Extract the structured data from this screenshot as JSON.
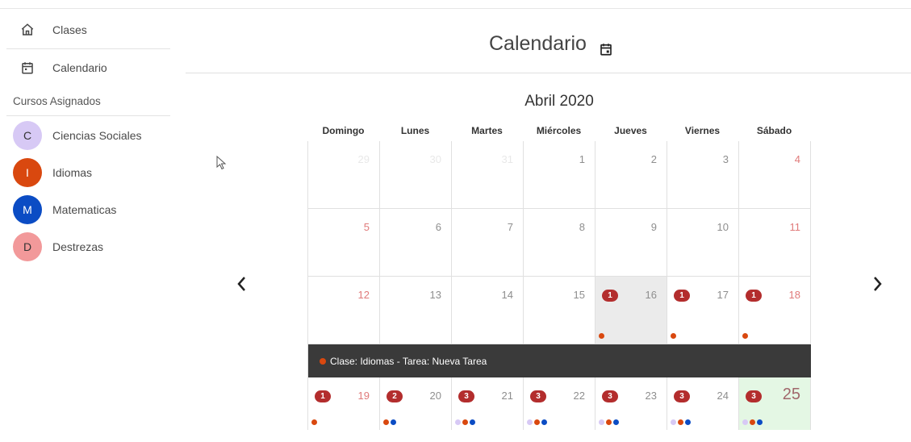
{
  "sidebar": {
    "nav": [
      {
        "label": "Clases",
        "icon": "home-icon"
      },
      {
        "label": "Calendario",
        "icon": "calendar-icon"
      }
    ],
    "section_label": "Cursos Asignados",
    "courses": [
      {
        "initial": "C",
        "name": "Ciencias Sociales",
        "color": "#d7c9f5",
        "text_color": "#333333"
      },
      {
        "initial": "I",
        "name": "Idiomas",
        "color": "#d9480f",
        "text_color": "#ffffff"
      },
      {
        "initial": "M",
        "name": "Matematicas",
        "color": "#0b4cc4",
        "text_color": "#ffffff"
      },
      {
        "initial": "D",
        "name": "Destrezas",
        "color": "#f2999a",
        "text_color": "#333333"
      }
    ]
  },
  "header": {
    "title": "Calendario",
    "icon": "calendar-event-icon"
  },
  "calendar": {
    "month": "Abril 2020",
    "days_of_week": [
      "Domingo",
      "Lunes",
      "Martes",
      "Miércoles",
      "Jueves",
      "Viernes",
      "Sábado"
    ],
    "weeks": [
      [
        "29",
        "30",
        "31",
        "1",
        "2",
        "3",
        "4"
      ],
      [
        "5",
        "6",
        "7",
        "8",
        "9",
        "10",
        "11"
      ],
      [
        "12",
        "13",
        "14",
        "15",
        "16",
        "17",
        "18"
      ],
      [
        "19",
        "20",
        "21",
        "22",
        "23",
        "24",
        "25"
      ]
    ],
    "badges": {
      "w2": [
        "",
        "",
        "",
        "",
        "1",
        "1",
        "1"
      ],
      "w3": [
        "1",
        "2",
        "3",
        "3",
        "3",
        "3",
        "3"
      ]
    },
    "event_text": "Clase: Idiomas - Tarea: Nueva Tarea",
    "colors": {
      "lavender": "#d7c9f5",
      "orange": "#d9480f",
      "blue": "#0b4cc4",
      "badge": "#b32d2d"
    }
  }
}
